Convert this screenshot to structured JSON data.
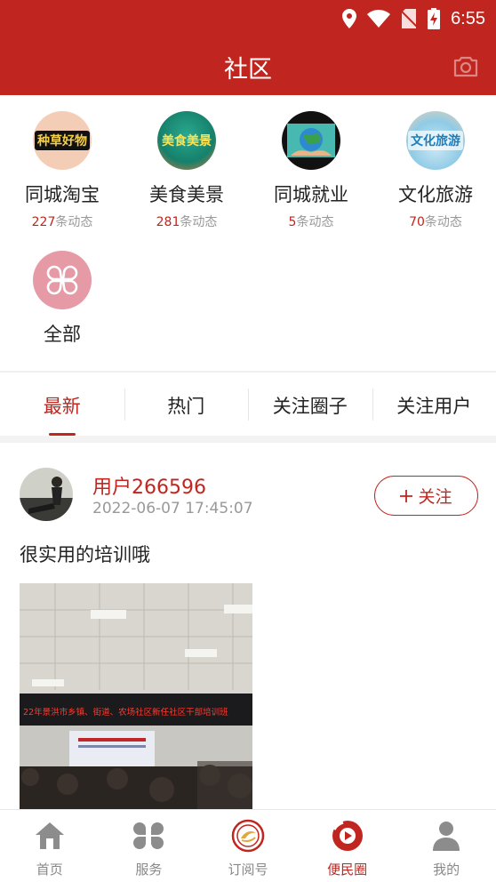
{
  "status_bar": {
    "time": "6:55"
  },
  "header": {
    "title": "社区",
    "camera_icon": "camera-icon"
  },
  "colors": {
    "brand": "#c0261f",
    "muted": "#999999"
  },
  "circles": [
    {
      "name": "同城淘宝",
      "count": "227",
      "suffix": "条动态",
      "thumb_text": "种草好物"
    },
    {
      "name": "美食美景",
      "count": "281",
      "suffix": "条动态",
      "thumb_text": "美食美景"
    },
    {
      "name": "同城就业",
      "count": "5",
      "suffix": "条动态",
      "thumb_text": ""
    },
    {
      "name": "文化旅游",
      "count": "70",
      "suffix": "条动态",
      "thumb_text": "文化旅游"
    },
    {
      "name": "全部",
      "icon": "clover-icon"
    }
  ],
  "tabs": [
    {
      "label": "最新",
      "active": true
    },
    {
      "label": "热门"
    },
    {
      "label": "关注圈子"
    },
    {
      "label": "关注用户"
    }
  ],
  "post": {
    "username": "用户266596",
    "time": "2022-06-07 17:45:07",
    "follow_label": "关注",
    "text": "很实用的培训哦",
    "banner_text": "22年景洪市乡镇、街道、农场社区新任社区干部培训班"
  },
  "bottom_nav": [
    {
      "label": "首页",
      "icon": "home-icon"
    },
    {
      "label": "服务",
      "icon": "grid-icon"
    },
    {
      "label": "订阅号",
      "icon": "subscription-icon"
    },
    {
      "label": "便民圈",
      "icon": "community-icon",
      "active": true
    },
    {
      "label": "我的",
      "icon": "user-icon"
    }
  ]
}
